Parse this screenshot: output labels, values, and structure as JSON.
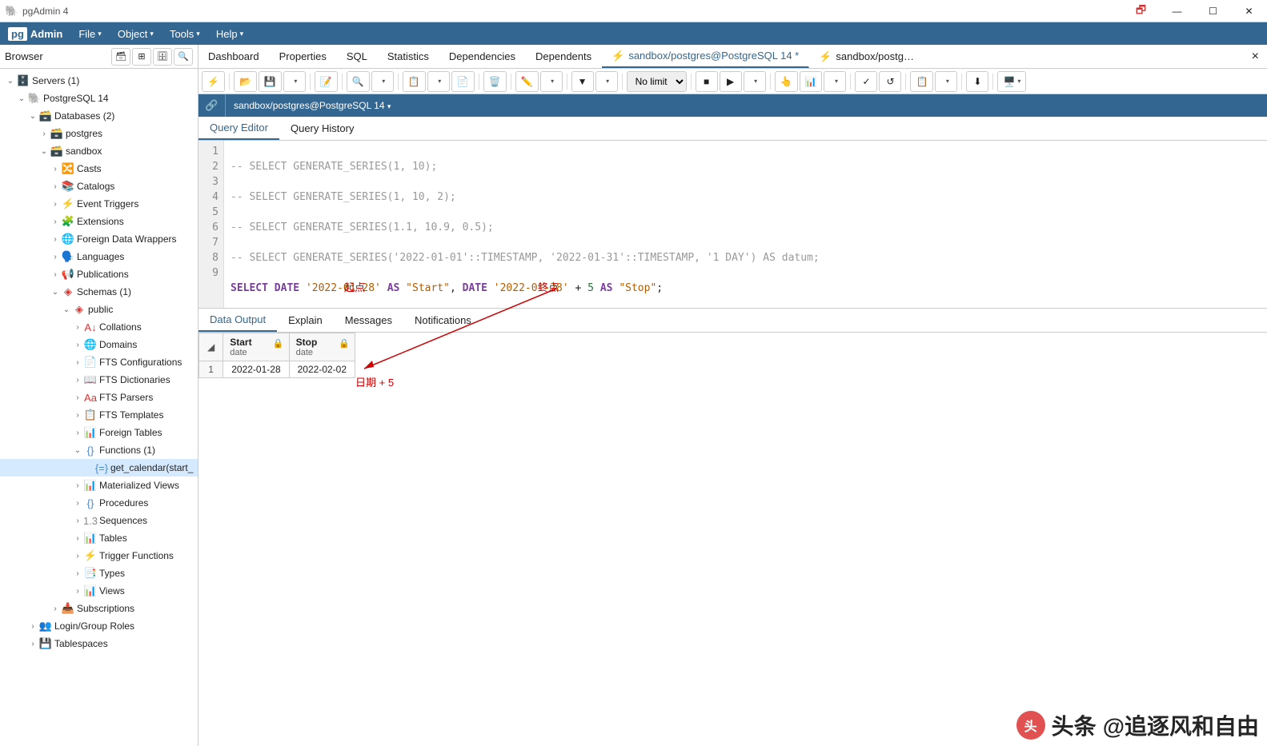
{
  "window": {
    "title": "pgAdmin 4"
  },
  "menu": {
    "logo_prefix": "pg",
    "logo_text": "Admin",
    "items": [
      "File",
      "Object",
      "Tools",
      "Help"
    ]
  },
  "browser": {
    "title": "Browser",
    "tree": [
      {
        "indent": 0,
        "chev": "⌄",
        "icon": "🗄️",
        "label": "Servers (1)",
        "color": "#336791"
      },
      {
        "indent": 1,
        "chev": "⌄",
        "icon": "🐘",
        "label": "PostgreSQL 14",
        "color": "#336791"
      },
      {
        "indent": 2,
        "chev": "⌄",
        "icon": "🗃️",
        "label": "Databases (2)",
        "color": "#c9a23e"
      },
      {
        "indent": 3,
        "chev": "›",
        "icon": "🗃️",
        "label": "postgres",
        "color": "#c9a23e"
      },
      {
        "indent": 3,
        "chev": "⌄",
        "icon": "🗃️",
        "label": "sandbox",
        "color": "#c9a23e"
      },
      {
        "indent": 4,
        "chev": "›",
        "icon": "🔀",
        "label": "Casts",
        "color": "#888"
      },
      {
        "indent": 4,
        "chev": "›",
        "icon": "📚",
        "label": "Catalogs",
        "color": "#c9a23e"
      },
      {
        "indent": 4,
        "chev": "›",
        "icon": "⚡",
        "label": "Event Triggers",
        "color": "#888"
      },
      {
        "indent": 4,
        "chev": "›",
        "icon": "🧩",
        "label": "Extensions",
        "color": "#4a8"
      },
      {
        "indent": 4,
        "chev": "›",
        "icon": "🌐",
        "label": "Foreign Data Wrappers",
        "color": "#888"
      },
      {
        "indent": 4,
        "chev": "›",
        "icon": "🗣️",
        "label": "Languages",
        "color": "#c9a23e"
      },
      {
        "indent": 4,
        "chev": "›",
        "icon": "📢",
        "label": "Publications",
        "color": "#888"
      },
      {
        "indent": 4,
        "chev": "⌄",
        "icon": "◈",
        "label": "Schemas (1)",
        "color": "#d33"
      },
      {
        "indent": 5,
        "chev": "⌄",
        "icon": "◈",
        "label": "public",
        "color": "#d33"
      },
      {
        "indent": 6,
        "chev": "›",
        "icon": "A↓",
        "label": "Collations",
        "color": "#d33"
      },
      {
        "indent": 6,
        "chev": "›",
        "icon": "🌐",
        "label": "Domains",
        "color": "#888"
      },
      {
        "indent": 6,
        "chev": "›",
        "icon": "📄",
        "label": "FTS Configurations",
        "color": "#48c"
      },
      {
        "indent": 6,
        "chev": "›",
        "icon": "📖",
        "label": "FTS Dictionaries",
        "color": "#48c"
      },
      {
        "indent": 6,
        "chev": "›",
        "icon": "Aa",
        "label": "FTS Parsers",
        "color": "#d33"
      },
      {
        "indent": 6,
        "chev": "›",
        "icon": "📋",
        "label": "FTS Templates",
        "color": "#48c"
      },
      {
        "indent": 6,
        "chev": "›",
        "icon": "📊",
        "label": "Foreign Tables",
        "color": "#48c"
      },
      {
        "indent": 6,
        "chev": "⌄",
        "icon": "{}",
        "label": "Functions (1)",
        "color": "#48c"
      },
      {
        "indent": 7,
        "chev": "",
        "icon": "{=}",
        "label": "get_calendar(start_",
        "color": "#48c",
        "selected": true
      },
      {
        "indent": 6,
        "chev": "›",
        "icon": "📊",
        "label": "Materialized Views",
        "color": "#4a8"
      },
      {
        "indent": 6,
        "chev": "›",
        "icon": "{}",
        "label": "Procedures",
        "color": "#48c"
      },
      {
        "indent": 6,
        "chev": "›",
        "icon": "1.3",
        "label": "Sequences",
        "color": "#888"
      },
      {
        "indent": 6,
        "chev": "›",
        "icon": "📊",
        "label": "Tables",
        "color": "#48c"
      },
      {
        "indent": 6,
        "chev": "›",
        "icon": "⚡",
        "label": "Trigger Functions",
        "color": "#48c"
      },
      {
        "indent": 6,
        "chev": "›",
        "icon": "📑",
        "label": "Types",
        "color": "#48c"
      },
      {
        "indent": 6,
        "chev": "›",
        "icon": "📊",
        "label": "Views",
        "color": "#48c"
      },
      {
        "indent": 4,
        "chev": "›",
        "icon": "📥",
        "label": "Subscriptions",
        "color": "#888"
      },
      {
        "indent": 2,
        "chev": "›",
        "icon": "👥",
        "label": "Login/Group Roles",
        "color": "#c9a23e"
      },
      {
        "indent": 2,
        "chev": "›",
        "icon": "💾",
        "label": "Tablespaces",
        "color": "#c9a23e"
      }
    ]
  },
  "tabs": {
    "list": [
      "Dashboard",
      "Properties",
      "SQL",
      "Statistics",
      "Dependencies",
      "Dependents"
    ],
    "query_tabs": [
      {
        "label": "sandbox/postgres@PostgreSQL 14 *",
        "active": true
      },
      {
        "label": "sandbox/postg…",
        "active": false
      }
    ]
  },
  "toolbar": {
    "limit_label": "No limit"
  },
  "conn": {
    "path": "sandbox/postgres@PostgreSQL 14"
  },
  "editor_tabs": {
    "active": "Query Editor",
    "other": "Query History"
  },
  "code": {
    "line1": "-- SELECT GENERATE_SERIES(1, 10);",
    "line2": "",
    "line3": "-- SELECT GENERATE_SERIES(1, 10, 2);",
    "line4": "",
    "line5": "-- SELECT GENERATE_SERIES(1.1, 10.9, 0.5);",
    "line6": "",
    "line7": "-- SELECT GENERATE_SERIES('2022-01-01'::TIMESTAMP, '2022-01-31'::TIMESTAMP, '1 DAY') AS datum;",
    "line8": "",
    "line9_kw1": "SELECT",
    "line9_kw2": "DATE",
    "line9_str1": "'2022-01-28'",
    "line9_kw3": "AS",
    "line9_str2": "\"Start\"",
    "line9_kw4": "DATE",
    "line9_str3": "'2022-01-28'",
    "line9_op": "+",
    "line9_num": "5",
    "line9_kw5": "AS",
    "line9_str4": "\"Stop\"",
    "anno1": "起点",
    "anno2": "终点",
    "anno3": "日期 + 5"
  },
  "result_tabs": [
    "Data Output",
    "Explain",
    "Messages",
    "Notifications"
  ],
  "grid": {
    "cols": [
      {
        "name": "Start",
        "type": "date"
      },
      {
        "name": "Stop",
        "type": "date"
      }
    ],
    "rows": [
      {
        "n": "1",
        "c0": "2022-01-28",
        "c1": "2022-02-02"
      }
    ]
  },
  "watermark": {
    "text1": "头条",
    "text2": "@追逐风和自由"
  }
}
